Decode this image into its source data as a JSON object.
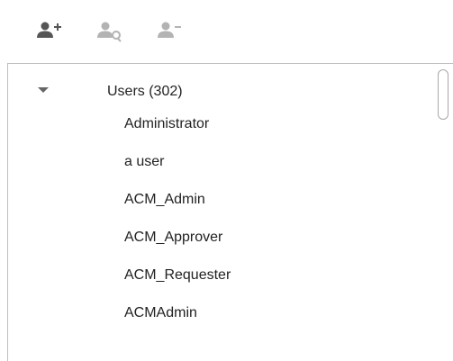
{
  "toolbar": {
    "buttons": [
      {
        "icon": "add-user-icon",
        "color": "#555555"
      },
      {
        "icon": "sync-user-icon",
        "color": "#b3b3b3"
      },
      {
        "icon": "remove-user-icon",
        "color": "#b3b3b3"
      }
    ]
  },
  "tree": {
    "root": {
      "label": "Users (302)",
      "expanded": true,
      "icon": "caret-down-icon"
    },
    "items": [
      {
        "label": "Administrator"
      },
      {
        "label": "a user"
      },
      {
        "label": "ACM_Admin"
      },
      {
        "label": "ACM_Approver"
      },
      {
        "label": "ACM_Requester"
      },
      {
        "label": "ACMAdmin"
      }
    ]
  },
  "scrollbar": {
    "position_fraction": 0.0
  }
}
